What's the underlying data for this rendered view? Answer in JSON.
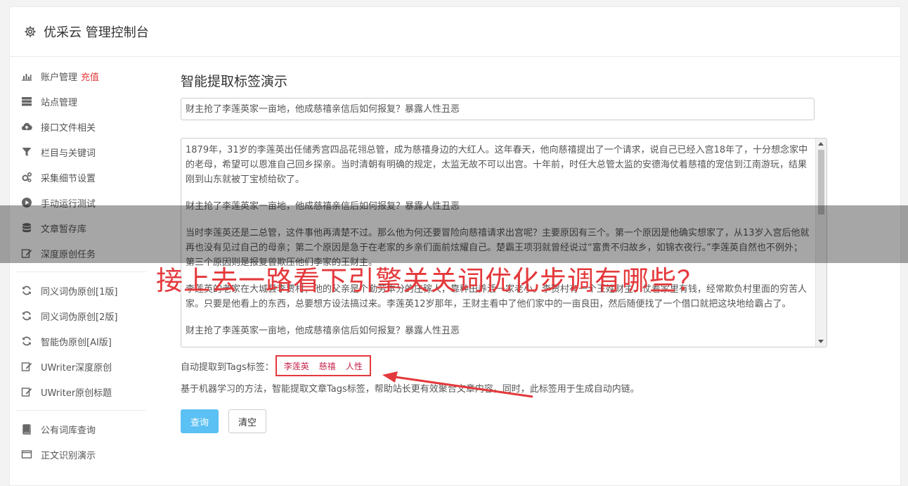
{
  "header": {
    "title": "优采云 管理控制台",
    "icon": "gear-icon"
  },
  "sidebar": {
    "group1": [
      {
        "label": "账户管理",
        "extra": "充值",
        "icon": "bar-chart-icon"
      },
      {
        "label": "站点管理",
        "icon": "server-icon"
      },
      {
        "label": "接口文件相关",
        "icon": "cloud-upload-icon"
      },
      {
        "label": "栏目与关键词",
        "icon": "filter-icon"
      },
      {
        "label": "采集细节设置",
        "icon": "gears-icon"
      },
      {
        "label": "手动运行测试",
        "icon": "play-circle-icon"
      },
      {
        "label": "文章暂存库",
        "icon": "database-icon"
      },
      {
        "label": "深度原创任务",
        "icon": "edit-icon"
      }
    ],
    "group2": [
      {
        "label": "同义词伪原创[1版]",
        "icon": "refresh-icon"
      },
      {
        "label": "同义词伪原创[2版]",
        "icon": "refresh-icon"
      },
      {
        "label": "智能伪原创[AI版]",
        "icon": "refresh-icon"
      },
      {
        "label": "UWriter深度原创",
        "icon": "edit-icon"
      },
      {
        "label": "UWriter原创标题",
        "icon": "edit-icon"
      }
    ],
    "group3": [
      {
        "label": "公有词库查询",
        "icon": "book-icon"
      },
      {
        "label": "正文识别演示",
        "icon": "window-icon"
      }
    ]
  },
  "main": {
    "title": "智能提取标签演示",
    "title_input_value": "财主抢了李莲英家一亩地，他成慈禧亲信后如何报复？暴露人性丑恶",
    "body_paragraphs": [
      "1879年，31岁的李莲英出任储秀宫四品花翎总管，成为慈禧身边的大红人。这年春天，他向慈禧提出了一个请求，说自己已经入宫18年了，十分想念家中的老母，希望可以恩准自己回乡探亲。当时清朝有明确的规定，太监无故不可以出宫。十年前，时任大总管太监的安德海仗着慈禧的宠信到江南游玩，结果刚到山东就被丁宝桢给砍了。",
      "财主抢了李莲英家一亩地，他成慈禧亲信后如何报复？暴露人性丑恶",
      "当时李莲英还是二总管，这件事他再清楚不过。那么他为何还要冒险向慈禧请求出宫呢？主要原因有三个。第一个原因是他确实想家了，从13岁入宫后他就再也没有见过自己的母亲；第二个原因是急于在老家的乡亲们面前炫耀自己。楚霸王项羽就曾经说过“富贵不归故乡，如锦衣夜行。”李莲英自然也不例外；第三个原因则是报复曾欺压他们李家的王财主。",
      "李莲英的老家在大城县李贾村，他的父亲是个勤劳本分的庄稼人，靠种田养活一家老小。李贾村有一个王姓财主，仗着家里有钱，经常欺负村里面的穷苦人家。只要是他看上的东西，总要想方设法搞过来。李莲英12岁那年，王财主看中了他们家中的一亩良田，然后随便找了一个借口就把这块地给霸占了。",
      "财主抢了李莲英家一亩地，他成慈禧亲信后如何报复？暴露人性丑恶"
    ],
    "tags_label": "自动提取到Tags标签：",
    "tags": [
      "李莲英",
      "慈禧",
      "人性"
    ],
    "description": "基于机器学习的方法，智能提取文章Tags标签，帮助站长更有效聚合文章内容，同时，此标签用于生成自动内链。",
    "query_button": "查询",
    "clear_button": "清空"
  },
  "overlay": {
    "headline": "接上去一路看下引擎关关词优化步调有哪些？"
  },
  "colors": {
    "accent_red": "#e4393c",
    "button_blue": "#5bc0f3",
    "tag_color": "#c7254e"
  }
}
